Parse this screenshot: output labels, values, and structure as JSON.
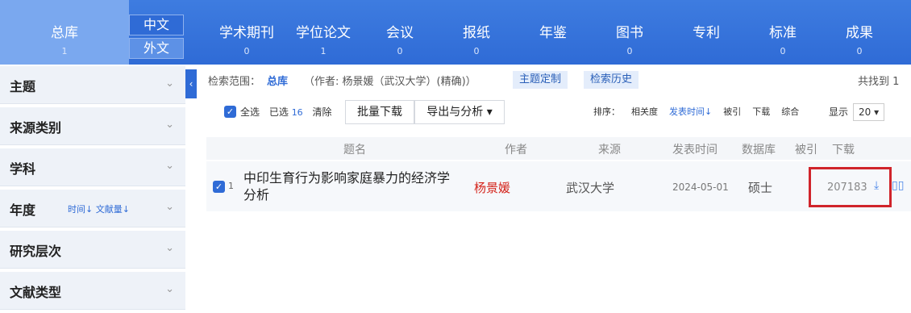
{
  "nav": {
    "total": {
      "label": "总库",
      "count": "1"
    },
    "lang": {
      "chinese": "中文",
      "foreign": "外文"
    },
    "categories": [
      {
        "label": "学术期刊",
        "count": "0"
      },
      {
        "label": "学位论文",
        "count": "1"
      },
      {
        "label": "会议",
        "count": "0"
      },
      {
        "label": "报纸",
        "count": "0"
      },
      {
        "label": "年鉴",
        "count": ""
      },
      {
        "label": "图书",
        "count": "0"
      },
      {
        "label": "专利",
        "count": ""
      },
      {
        "label": "标准",
        "count": "0"
      },
      {
        "label": "成果",
        "count": "0"
      }
    ]
  },
  "sidebar": {
    "items": [
      {
        "label": "主题"
      },
      {
        "label": "来源类别"
      },
      {
        "label": "学科"
      },
      {
        "label": "年度",
        "sort_time": "时间↓",
        "sort_count": "文献量↓"
      },
      {
        "label": "研究层次"
      },
      {
        "label": "文献类型"
      }
    ],
    "chevron": "⌄",
    "collapse": "‹"
  },
  "search": {
    "scope_label": "检索范围：",
    "scope_value": "总库",
    "query": "（作者: 杨景媛（武汉大学）(精确)）",
    "custom_topic": "主题定制",
    "history": "检索历史",
    "found": "共找到 1"
  },
  "toolbar": {
    "select_all": "全选",
    "selected_label": "已选",
    "selected_count": "16",
    "clear": "清除",
    "batch_download": "批量下载",
    "export": "导出与分析 ▾",
    "sort_label": "排序：",
    "sort_relevance": "相关度",
    "sort_date": "发表时间↓",
    "sort_cited": "被引",
    "sort_download": "下载",
    "sort_overall": "综合",
    "show_label": "显示",
    "show_value": "20 ▾"
  },
  "table": {
    "headers": {
      "title": "题名",
      "author": "作者",
      "source": "来源",
      "date": "发表时间",
      "db": "数据库",
      "cited": "被引",
      "download": "下载"
    },
    "rows": [
      {
        "index": "1",
        "title": "中印生育行为影响家庭暴力的经济学分析",
        "author": "杨景媛",
        "source": "武汉大学",
        "date": "2024-05-01",
        "db": "硕士",
        "cited": "",
        "download": "207183"
      }
    ]
  },
  "colors": {
    "brand": "#2f6bd6",
    "author": "#d4231a",
    "highlight": "#d0242b"
  }
}
